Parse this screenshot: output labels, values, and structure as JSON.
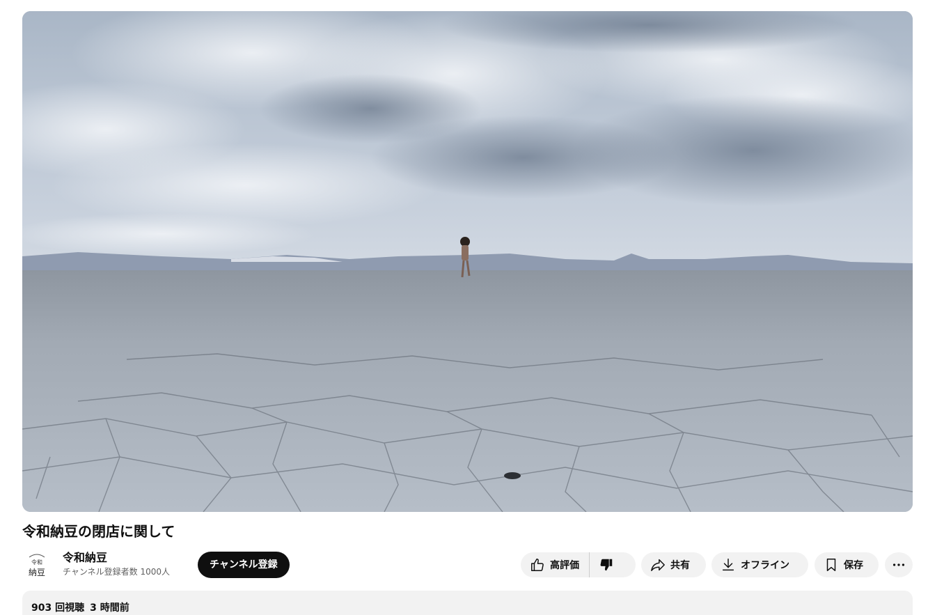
{
  "video": {
    "title": "令和納豆の閉店に関して",
    "thumbnail_icon": "video-frame"
  },
  "channel": {
    "name": "令和納豆",
    "subscribers": "チャンネル登録者数 1000人",
    "avatar_text_top": "令和",
    "avatar_text_bottom": "納豆",
    "subscribe_label": "チャンネル登録"
  },
  "actions": {
    "like_label": "高評価",
    "like_icon": "thumbs-up-icon",
    "dislike_icon": "thumbs-down-icon",
    "share_label": "共有",
    "share_icon": "share-icon",
    "download_label": "オフライン",
    "download_icon": "download-icon",
    "save_label": "保存",
    "save_icon": "bookmark-icon",
    "more_icon": "more-horizontal-icon"
  },
  "description": {
    "views": "903 回視聴",
    "published": "3 時間前"
  },
  "colors": {
    "subscribe_bg": "#0f0f0f",
    "pill_bg": "#f2f2f2",
    "secondary_text": "#606060"
  }
}
